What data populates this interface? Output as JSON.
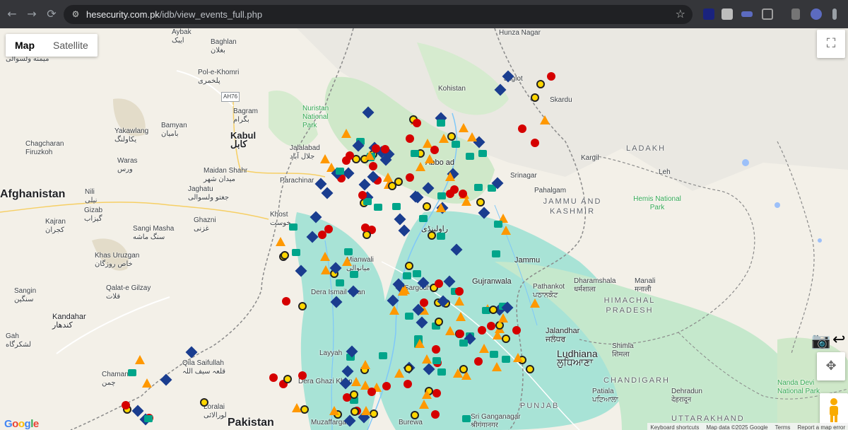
{
  "browser": {
    "url_host": "hesecurity.com.pk",
    "url_path": "/idb/view_events_full.php",
    "back_icon": "←",
    "forward_icon": "→",
    "reload_icon": "⟳",
    "site_info_icon": "⚙",
    "bookmark_icon": "☆"
  },
  "map": {
    "map_type": {
      "map_label": "Map",
      "satellite_label": "Satellite"
    },
    "fullscreen_icon": "⛶",
    "camera_icon": "📷",
    "undo_icon": "↩",
    "locate_icon": "✥",
    "google_logo": "Google",
    "footer": {
      "shortcuts": "Keyboard shortcuts",
      "map_data": "Map data ©2025 Google",
      "terms": "Terms",
      "report": "Report a map error"
    },
    "labels": {
      "aybak": "Aybak",
      "aybak_ur": "ایبک",
      "baghlan": "Baghlan",
      "baghlan_ur": "بغلان",
      "meymaneh": "میمنه ولسوالی",
      "pol_e_khomri": "Pol-e-Khomri",
      "pol_e_khomri_ur": "پلخمری",
      "ah76": "AH76",
      "bagram": "Bagram",
      "bagram_ur": "بگرام",
      "bamyan": "Bamyan",
      "bamyan_ur": "بامیان",
      "yakawlang": "Yakawlang",
      "yakawlang_ur": "یکاولنگ",
      "kabul": "Kabul",
      "kabul_ur": "کابل",
      "chagcharan": "Chagcharan",
      "firuzkoh": "Firuzkoh",
      "waras": "Waras",
      "waras_ur": "ورس",
      "maidan_shahr": "Maidan Shahr",
      "maidan_shahr_ur": "میدان شهر",
      "jalalabad": "Jalalabad",
      "jalalabad_ur": "جلال آباد",
      "nuristan": "Nuristan National Park",
      "afghanistan": "Afghanistan",
      "nili": "Nili",
      "nili_ur": "نیلی",
      "gizab": "Gizab",
      "gizab_ur": "گیزاب",
      "jaghatu": "Jaghatu",
      "jaghatu_ur": "جغتو ولسوالی",
      "ghazni": "Ghazni",
      "ghazni_ur": "غزنی",
      "kajran": "Kajran",
      "kajran_ur": "کجران",
      "sangi_masha": "Sangi Masha",
      "sangi_masha_ur": "سنگ ماشه",
      "khas_uruzgan": "Khas Uruzgan",
      "khas_uruzgan_ur": "خاص روزگان",
      "khost": "Khost",
      "khost_ur": "خوست",
      "parachinar": "Parachinar",
      "qalat": "Qalat-e Gilzay",
      "qalat_ur": "قلات",
      "sangin": "Sangin",
      "sangin_ur": "سنگین",
      "kandahar": "Kandahar",
      "kandahar_ur": "کندهار",
      "gah": "Gah",
      "lashkar": "لشکرگاه",
      "chaman": "Chaman",
      "chaman_ur": "چمن",
      "qila_saifullah": "Qila Saifullah",
      "qila_saifullah_ur": "قلعہ سیف اللہ",
      "loralai": "Loralai",
      "loralai_ur": "لورالائی",
      "pakistan": "Pakistan",
      "hunza": "Hunza Nagar",
      "jaglot": "Jaglot",
      "skardu": "Skardu",
      "kohistan": "Kohistan",
      "ladakh": "LADAKH",
      "kargil": "Kargil",
      "leh": "Leh",
      "srinagar": "Srinagar",
      "pahalgam": "Pahalgam",
      "hemis": "Hemis National Park",
      "jk": "JAMMU AND KASHMIR",
      "abbottabad": "Abbo   ad",
      "rawalpindi": "راولپنڈی",
      "mianwali": "Mianwali",
      "mianwali_ur": "میانوالی",
      "jammu": "Jammu",
      "gujranwala": "Gujranwala",
      "pathankot": "Pathankot",
      "pathankot_pa": "ਪਠਾਨਕੋਟ",
      "dharamshala": "Dharamshala",
      "dharamshala_hi": "धर्मशाला",
      "manali": "Manali",
      "manali_hi": "मनाली",
      "himachal": "HIMACHAL PRADESH",
      "sargodha": "Sargodha",
      "dera_ismail": "Dera Ismail Khan",
      "layyah": "Layyah",
      "dera_ghazi": "Dera Ghazi Khan",
      "muzaffargarh": "Muzaffargarh",
      "jalandhar": "Jalandhar",
      "jalandhar_pa": "ਜਲੰਧਰ",
      "ludhiana": "Ludhiana",
      "ludhiana_pa": "ਲੁਧਿਆਣਾ",
      "shimla": "Shimla",
      "shimla_hi": "शिमला",
      "chandigarh": "CHANDIGARH",
      "patiala": "Patiala",
      "patiala_pa": "ਪਟਿਆਲਾ",
      "dehradun": "Dehradun",
      "dehradun_hi": "देहरादून",
      "nanda_devi": "Nanda Devi National Park",
      "punjab": "PUNJAB",
      "uttarakhand": "UTTARAKHAND",
      "sri_ganganagar": "Sri Ganganagar",
      "sri_ganganagar_hi": "श्रीगंगानगर",
      "burewala": "Burewa"
    },
    "legend_colors": {
      "terrain": "#f3f0e8",
      "vegetation": "#cfe8c9",
      "river_plain": "#a8e3d6",
      "mountains": "#e6e3dc",
      "water": "#9cc0f9",
      "warning": "#ff9800",
      "alert_red": "#d50000",
      "info_blue": "#1a3d8f",
      "marker_teal": "#00a58a"
    }
  }
}
